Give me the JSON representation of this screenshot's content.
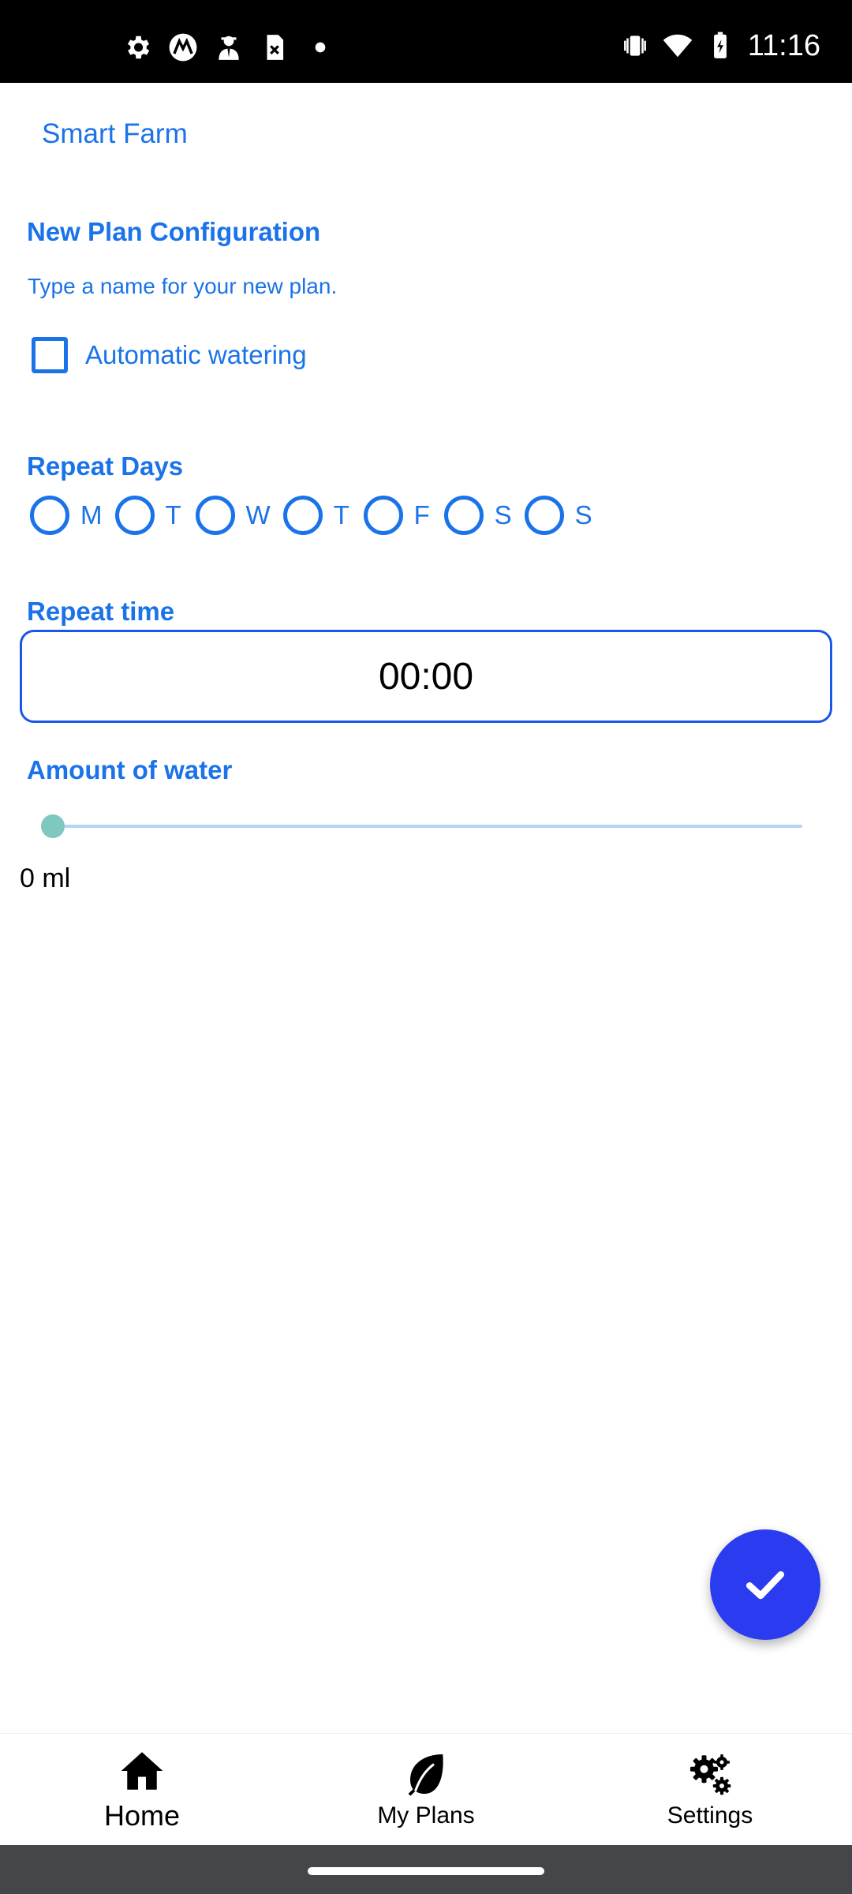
{
  "status_bar": {
    "time": "11:16",
    "left_icons": [
      "settings-icon",
      "motorola-icon",
      "agent-icon",
      "sim-icon",
      "dot-icon"
    ],
    "right_icons": [
      "vibrate-icon",
      "wifi-icon",
      "battery-icon"
    ]
  },
  "app": {
    "title": "Smart Farm"
  },
  "form": {
    "heading": "New Plan Configuration",
    "name_hint": "Type a name for your new plan.",
    "auto_watering": {
      "label": "Automatic watering",
      "checked": false
    },
    "repeat_days": {
      "title": "Repeat Days",
      "days": [
        {
          "label": "M",
          "selected": false
        },
        {
          "label": "T",
          "selected": false
        },
        {
          "label": "W",
          "selected": false
        },
        {
          "label": "T",
          "selected": false
        },
        {
          "label": "F",
          "selected": false
        },
        {
          "label": "S",
          "selected": false
        },
        {
          "label": "S",
          "selected": false
        }
      ]
    },
    "repeat_time": {
      "title": "Repeat time",
      "value": "00:00"
    },
    "amount_of_water": {
      "title": "Amount of water",
      "value": 0,
      "value_text": "0 ml"
    }
  },
  "fab": {
    "icon": "check-icon"
  },
  "bottom_nav": {
    "items": [
      {
        "label": "Home",
        "icon": "home-icon",
        "active": true
      },
      {
        "label": "My Plans",
        "icon": "leaf-icon",
        "active": false
      },
      {
        "label": "Settings",
        "icon": "gears-icon",
        "active": false
      }
    ]
  },
  "colors": {
    "accent": "#1a73e8",
    "fab": "#2b3cf0",
    "slider_thumb": "#7ec8c0",
    "status_bar": "#000000"
  }
}
